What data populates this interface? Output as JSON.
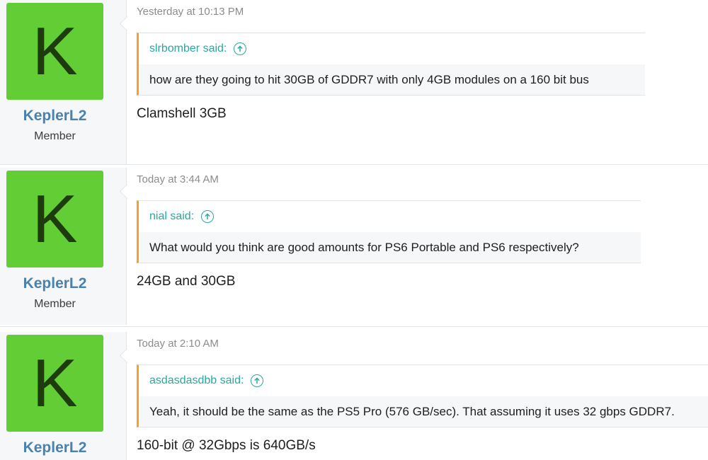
{
  "posts": [
    {
      "avatar_letter": "K",
      "username": "KeplerL2",
      "user_title": "Member",
      "timestamp": "Yesterday at 10:13 PM",
      "quote_author": "slrbomber said:",
      "quote_text": "how are they going to hit 30GB of GDDR7 with only 4GB modules on a 160 bit bus",
      "reply": "Clamshell 3GB"
    },
    {
      "avatar_letter": "K",
      "username": "KeplerL2",
      "user_title": "Member",
      "timestamp": "Today at 3:44 AM",
      "quote_author": "nial said:",
      "quote_text": "What would you think are good amounts for PS6 Portable and PS6 respectively?",
      "reply": "24GB and 30GB"
    },
    {
      "avatar_letter": "K",
      "username": "KeplerL2",
      "user_title": "",
      "timestamp": "Today at 2:10 AM",
      "quote_author": "asdasdasdbb said:",
      "quote_text": "Yeah, it should be the same as the PS5 Pro (576 GB/sec). That assuming it uses 32 gbps GDDR7.",
      "reply": "160-bit @ 32Gbps is 640GB/s"
    }
  ],
  "icons": {
    "quote_jump": "arrow-up-circle-icon"
  },
  "colors": {
    "avatar_bg": "#62cd35",
    "username": "#4b81ad",
    "quote_accent": "#f1a22b",
    "quote_author": "#2aa7a1"
  }
}
